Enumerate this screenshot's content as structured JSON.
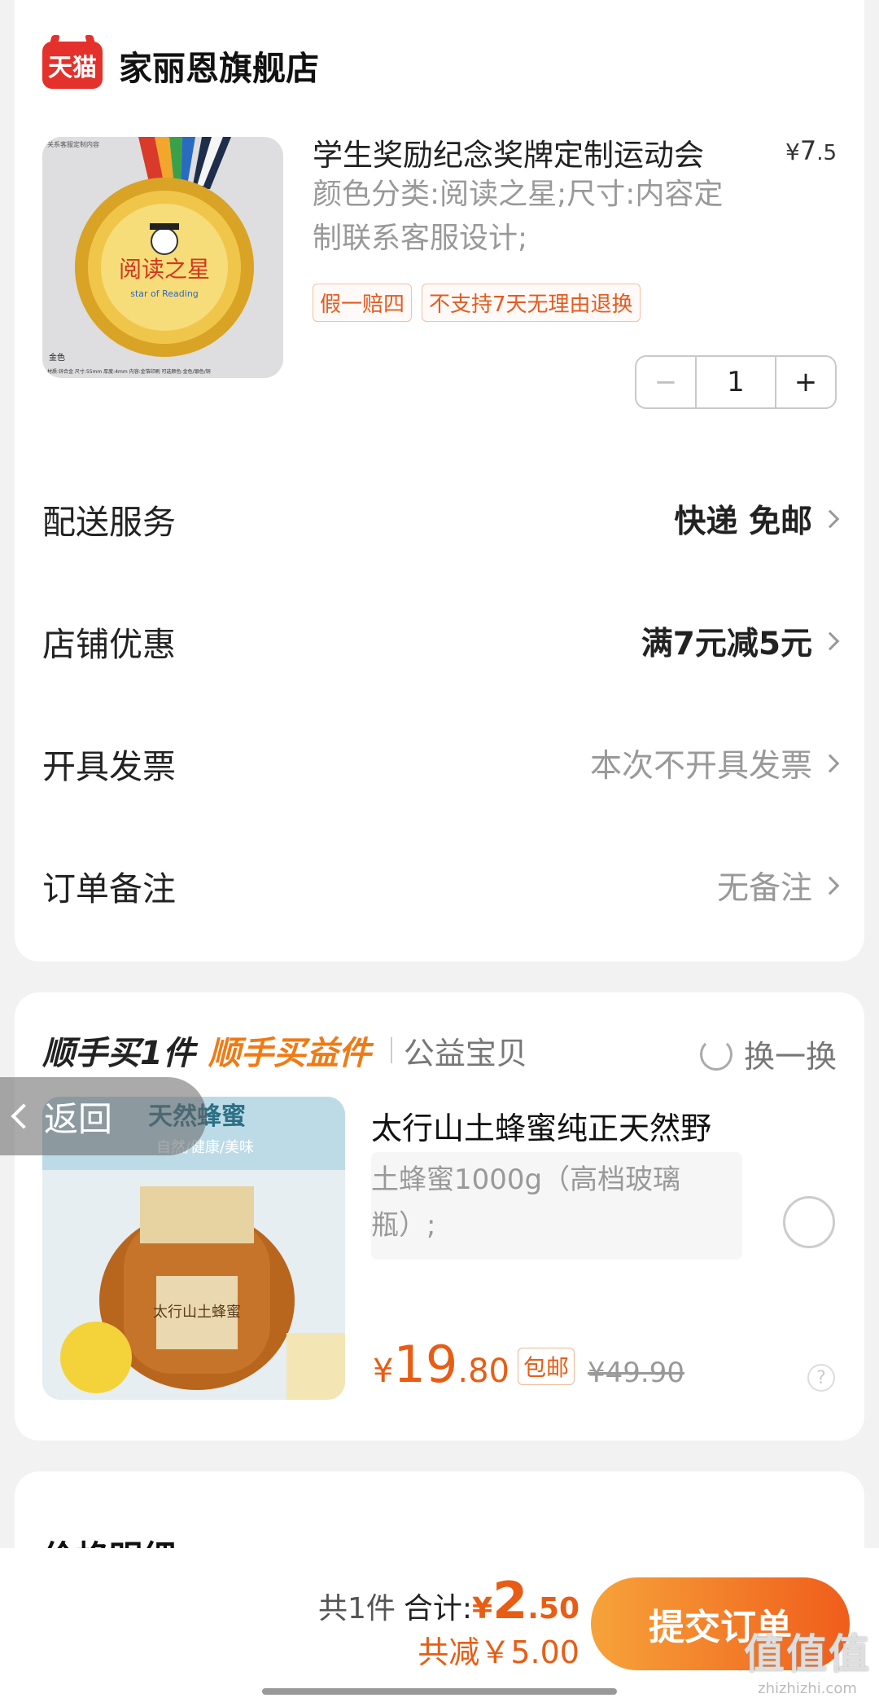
{
  "shop": {
    "logo_text": "天猫",
    "name": "家丽恩旗舰店"
  },
  "product": {
    "title": "学生奖励纪念奖牌定制运动会",
    "price_currency": "¥",
    "price_int": "7",
    "price_dec": ".5",
    "spec": "颜色分类:阅读之星;尺寸:内容定制联系客服设计;",
    "tags": [
      "假一赔四",
      "不支持7天无理由退换"
    ],
    "quantity": "1",
    "minus": "−",
    "plus": "+",
    "image": {
      "top_caption": "关系客服定制内容",
      "medal_text": "阅读之星",
      "medal_sub": "star of Reading",
      "color_label": "金色",
      "bottom_caption": "材质:锌合金  尺寸:55mm  厚度:4mm  内容:金箔印刷  可选颜色:金色/银色/铜"
    }
  },
  "rows": [
    {
      "label": "配送服务",
      "value": "快递 免邮",
      "style": "dark"
    },
    {
      "label": "店铺优惠",
      "value": "满7元减5元",
      "style": "dark"
    },
    {
      "label": "开具发票",
      "value": "本次不开具发票",
      "style": "light"
    },
    {
      "label": "订单备注",
      "value": "无备注",
      "style": "light"
    }
  ],
  "addon": {
    "head1": "顺手买1件",
    "head2": "顺手买益件",
    "head3": "公益宝贝",
    "swap": "换一换",
    "title": "太行山土蜂蜜纯正天然野",
    "spec": "土蜂蜜1000g（高档玻璃瓶）;",
    "price_currency": "¥",
    "price_int": "19",
    "price_dec": ".80",
    "badge": "包邮",
    "orig_price": "¥49.90",
    "qmark": "?",
    "image": {
      "banner": "天然蜂蜜",
      "banner_sub": "自然/健康/美味",
      "label_text": "太行山土蜂蜜"
    }
  },
  "back_overlay": {
    "label": "返回"
  },
  "price_detail": {
    "title": "价格明细"
  },
  "bottom": {
    "count": "共1件",
    "total_label": "合计:",
    "cur": "¥",
    "int": "2",
    "dec": ".50",
    "saved": "共减￥5.00",
    "submit": "提交订单"
  },
  "watermark": {
    "main": "值值值",
    "sub": "zhizhizhi.com"
  },
  "colors": {
    "accent": "#e85d14",
    "tmall_red": "#e4312b",
    "button_start": "#f6a33a",
    "button_end": "#f05d1b"
  }
}
